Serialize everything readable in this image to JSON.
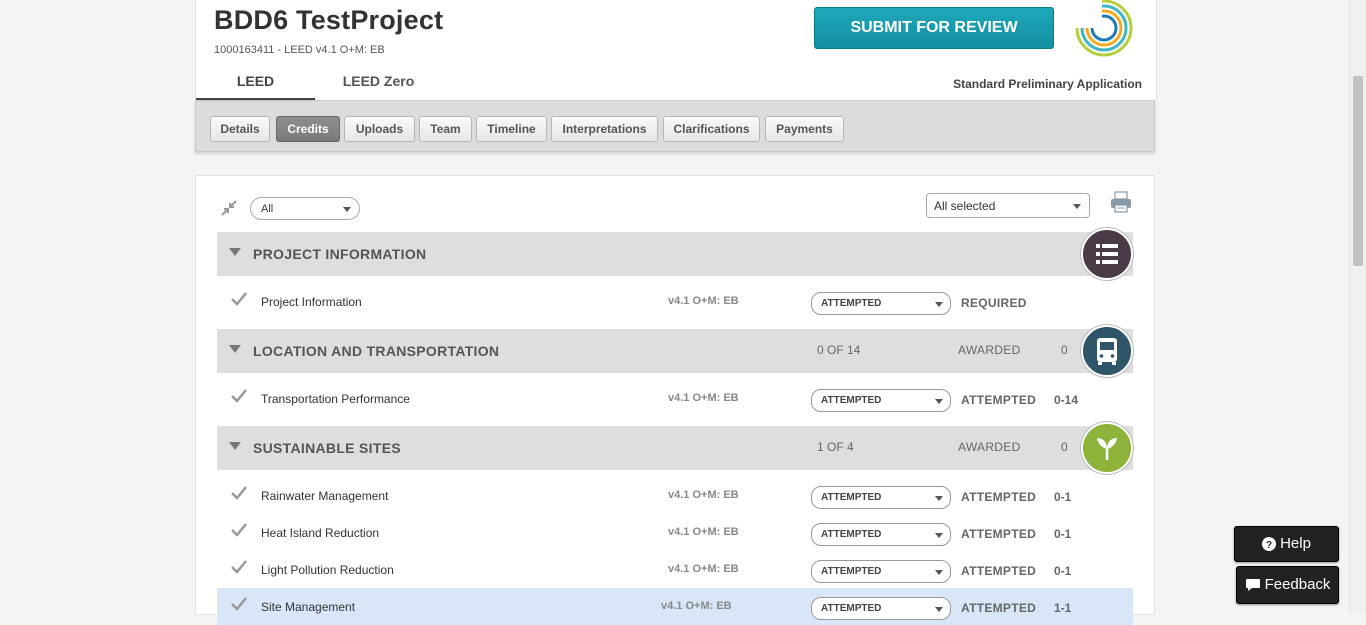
{
  "project": {
    "title": "BDD6 TestProject",
    "subtitle": "1000163411 - LEED v4.1 O+M: EB",
    "submit_label": "SUBMIT FOR REVIEW",
    "application_type": "Standard Preliminary Application"
  },
  "tabs": [
    "LEED",
    "LEED Zero"
  ],
  "subnav": [
    "Details",
    "Credits",
    "Uploads",
    "Team",
    "Timeline",
    "Interpretations",
    "Clarifications",
    "Payments"
  ],
  "filters": {
    "category_filter": "All",
    "status_filter": "All selected"
  },
  "categories": [
    {
      "name": "PROJECT INFORMATION",
      "count": "",
      "awarded_label": "",
      "points": "",
      "color": "#4a3b47",
      "icon": "list-icon"
    },
    {
      "name": "LOCATION AND TRANSPORTATION",
      "count": "0 OF 14",
      "awarded_label": "AWARDED",
      "points": "0",
      "color": "#2e5568",
      "icon": "bus-icon"
    },
    {
      "name": "SUSTAINABLE SITES",
      "count": "1 OF 4",
      "awarded_label": "AWARDED",
      "points": "0",
      "color": "#8db33a",
      "icon": "sprout-icon"
    }
  ],
  "credits": [
    {
      "name": "Project Information",
      "version": "v4.1 O+M: EB",
      "status": "ATTEMPTED",
      "state": "REQUIRED",
      "points": ""
    },
    {
      "name": "Transportation Performance",
      "version": "v4.1 O+M: EB",
      "status": "ATTEMPTED",
      "state": "ATTEMPTED",
      "points": "0-14"
    },
    {
      "name": "Rainwater Management",
      "version": "v4.1 O+M: EB",
      "status": "ATTEMPTED",
      "state": "ATTEMPTED",
      "points": "0-1"
    },
    {
      "name": "Heat Island Reduction",
      "version": "v4.1 O+M: EB",
      "status": "ATTEMPTED",
      "state": "ATTEMPTED",
      "points": "0-1"
    },
    {
      "name": "Light Pollution Reduction",
      "version": "v4.1 O+M: EB",
      "status": "ATTEMPTED",
      "state": "ATTEMPTED",
      "points": "0-1"
    },
    {
      "name": "Site Management",
      "version": "v4.1 O+M: EB",
      "status": "ATTEMPTED",
      "state": "ATTEMPTED",
      "points": "1-1"
    }
  ],
  "floating": {
    "help_label": "Help",
    "feedback_label": "Feedback"
  },
  "colors": {
    "accent": "#1a9db1",
    "active_tab": "#7f7f7f",
    "highlight_row": "#d9e6f8"
  }
}
